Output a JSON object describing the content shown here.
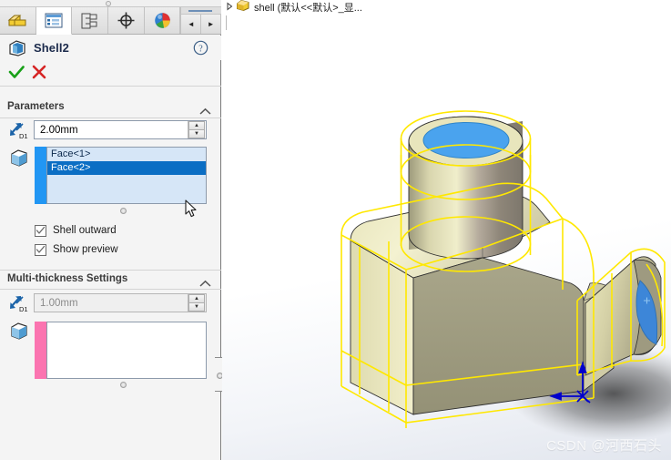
{
  "panel": {
    "tabs": [
      {
        "name": "feature-manager-design-tree",
        "icon": "feature-tree-icon",
        "active": false
      },
      {
        "name": "property-manager",
        "icon": "property-manager-icon",
        "active": true
      },
      {
        "name": "configuration-manager",
        "icon": "configuration-manager-icon",
        "active": false
      },
      {
        "name": "dimxpert-manager",
        "icon": "dimxpert-icon",
        "active": false
      },
      {
        "name": "display-manager",
        "icon": "display-manager-icon",
        "active": false
      }
    ],
    "nav": {
      "prev_label": "◄",
      "next_label": "►"
    },
    "feature": {
      "title": "Shell2",
      "icon": "shell-feature-icon",
      "help_icon": "help-question-icon",
      "ok_icon": "green-check-icon",
      "cancel_icon": "red-x-icon"
    },
    "parameters": {
      "title": "Parameters",
      "collapse_icon": "chevron-up-icon",
      "thickness": {
        "icon": "d1-thickness-icon",
        "value": "2.00mm",
        "spin_up": "▲",
        "spin_down": "▼"
      },
      "faces": {
        "icon": "face-cube-icon",
        "items": [
          {
            "label": "Face<1>",
            "selected": false
          },
          {
            "label": "Face<2>",
            "selected": true
          }
        ]
      },
      "checkboxes": [
        {
          "label": "Shell outward",
          "checked": true
        },
        {
          "label": "Show preview",
          "checked": true
        }
      ]
    },
    "multi_thickness": {
      "title": "Multi-thickness Settings",
      "collapse_icon": "chevron-up-icon",
      "thickness": {
        "icon": "d1-thickness-icon",
        "value": "1.00mm",
        "disabled": true,
        "spin_up": "▲",
        "spin_down": "▼"
      },
      "faces": {
        "icon": "face-cube-icon",
        "items": []
      }
    }
  },
  "graphics": {
    "breadcrumb": {
      "expand_icon": "triangle-right-icon",
      "part_icon": "part-document-icon",
      "text": "shell (默认<<默认>_显..."
    },
    "watermark": "CSDN @河西石头",
    "model": {
      "name": "shell-part-3d-model",
      "preview_color": "#ffe800",
      "selected_face_color": "#4aa3ee",
      "body_color": "#b7b48e",
      "origin_color": "#0000cc"
    }
  }
}
